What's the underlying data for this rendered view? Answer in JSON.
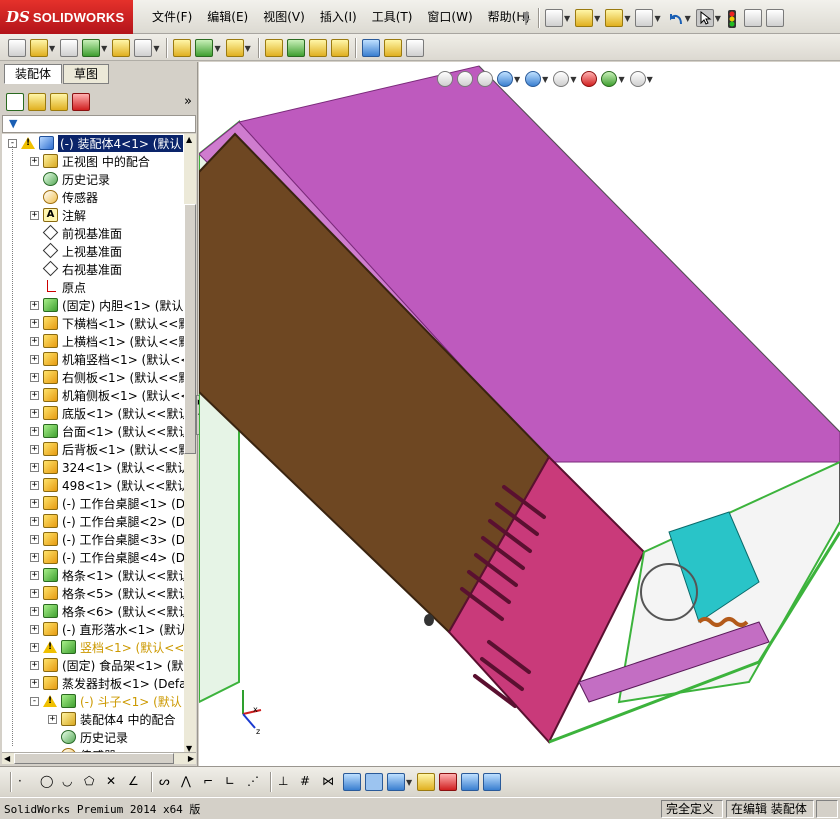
{
  "app": {
    "brand_prefix": "DS",
    "brand_name": "SOLIDWORKS"
  },
  "menu": [
    {
      "label": "文件(F)"
    },
    {
      "label": "编辑(E)"
    },
    {
      "label": "视图(V)"
    },
    {
      "label": "插入(I)"
    },
    {
      "label": "工具(T)"
    },
    {
      "label": "窗口(W)"
    },
    {
      "label": "帮助(H)"
    }
  ],
  "panel": {
    "tabs": [
      {
        "label": "装配体"
      },
      {
        "label": "草图"
      }
    ],
    "tree": [
      {
        "label": "(-) 装配体4<1> (默认",
        "icon": "asm",
        "selected": true,
        "warning": true,
        "expander": "-"
      },
      {
        "label": "正视图 中的配合",
        "icon": "mate",
        "expander": "+"
      },
      {
        "label": "历史记录",
        "icon": "hist",
        "expander": ""
      },
      {
        "label": "传感器",
        "icon": "sens",
        "expander": ""
      },
      {
        "label": "注解",
        "icon": "note",
        "expander": "+"
      },
      {
        "label": "前视基准面",
        "icon": "plane",
        "expander": ""
      },
      {
        "label": "上视基准面",
        "icon": "plane",
        "expander": ""
      },
      {
        "label": "右视基准面",
        "icon": "plane",
        "expander": ""
      },
      {
        "label": "原点",
        "icon": "origin",
        "expander": ""
      },
      {
        "label": "(固定) 内胆<1> (默认",
        "icon": "partg",
        "expander": "+"
      },
      {
        "label": "下横档<1> (默认<<默认",
        "icon": "part",
        "expander": "+"
      },
      {
        "label": "上横档<1> (默认<<默认",
        "icon": "part",
        "expander": "+"
      },
      {
        "label": "机箱竖档<1> (默认<<默",
        "icon": "part",
        "expander": "+"
      },
      {
        "label": "右侧板<1> (默认<<默认",
        "icon": "part",
        "expander": "+"
      },
      {
        "label": "机箱侧板<1> (默认<<默",
        "icon": "part",
        "expander": "+"
      },
      {
        "label": "底版<1> (默认<<默认>_",
        "icon": "part",
        "expander": "+"
      },
      {
        "label": "台面<1> (默认<<默认>_显",
        "icon": "partg",
        "expander": "+"
      },
      {
        "label": "后背板<1> (默认<<默认",
        "icon": "part",
        "expander": "+"
      },
      {
        "label": "324<1> (默认<<默认>_",
        "icon": "part",
        "expander": "+"
      },
      {
        "label": "498<1> (默认<<默认>_",
        "icon": "part",
        "expander": "+"
      },
      {
        "label": "(-) 工作台桌腿<1> (D",
        "icon": "part",
        "expander": "+"
      },
      {
        "label": "(-) 工作台桌腿<2> (D",
        "icon": "part",
        "expander": "+"
      },
      {
        "label": "(-) 工作台桌腿<3> (D",
        "icon": "part",
        "expander": "+"
      },
      {
        "label": "(-) 工作台桌腿<4> (D",
        "icon": "part",
        "expander": "+"
      },
      {
        "label": "格条<1> (默认<<默认>_显",
        "icon": "partg",
        "expander": "+"
      },
      {
        "label": "格条<5> (默认<<默认>_显",
        "icon": "part",
        "expander": "+"
      },
      {
        "label": "格条<6> (默认<<默认>_显",
        "icon": "partg",
        "expander": "+"
      },
      {
        "label": "(-) 直形落水<1> (默认",
        "icon": "part",
        "expander": "+"
      },
      {
        "label": "竖档<1> (默认<<默认",
        "icon": "partg",
        "warning": true,
        "yellow": true,
        "expander": "+"
      },
      {
        "label": "(固定) 食品架<1> (默认",
        "icon": "part",
        "expander": "+"
      },
      {
        "label": "蒸发器封板<1> (Defau",
        "icon": "part",
        "expander": "+"
      },
      {
        "label": "(-) 斗子<1> (默认",
        "icon": "partg",
        "warning": true,
        "yellow": true,
        "expander": "-"
      },
      {
        "label": "装配体4 中的配合",
        "icon": "mate",
        "expander": "+",
        "indent": 1
      },
      {
        "label": "历史记录",
        "icon": "hist",
        "expander": "",
        "indent": 1
      },
      {
        "label": "传感器",
        "icon": "sens",
        "expander": "",
        "indent": 1
      }
    ]
  },
  "statusbar": {
    "product": "SolidWorks Premium 2014 x64 版",
    "definition": "完全定义",
    "mode": "在编辑 装配体"
  },
  "colors": {
    "top_face": "#be5abe",
    "door": "#6e4722",
    "vent_panel": "#c93a7a",
    "frame": "#3cb33c",
    "accent_cyan": "#29c4c8"
  }
}
